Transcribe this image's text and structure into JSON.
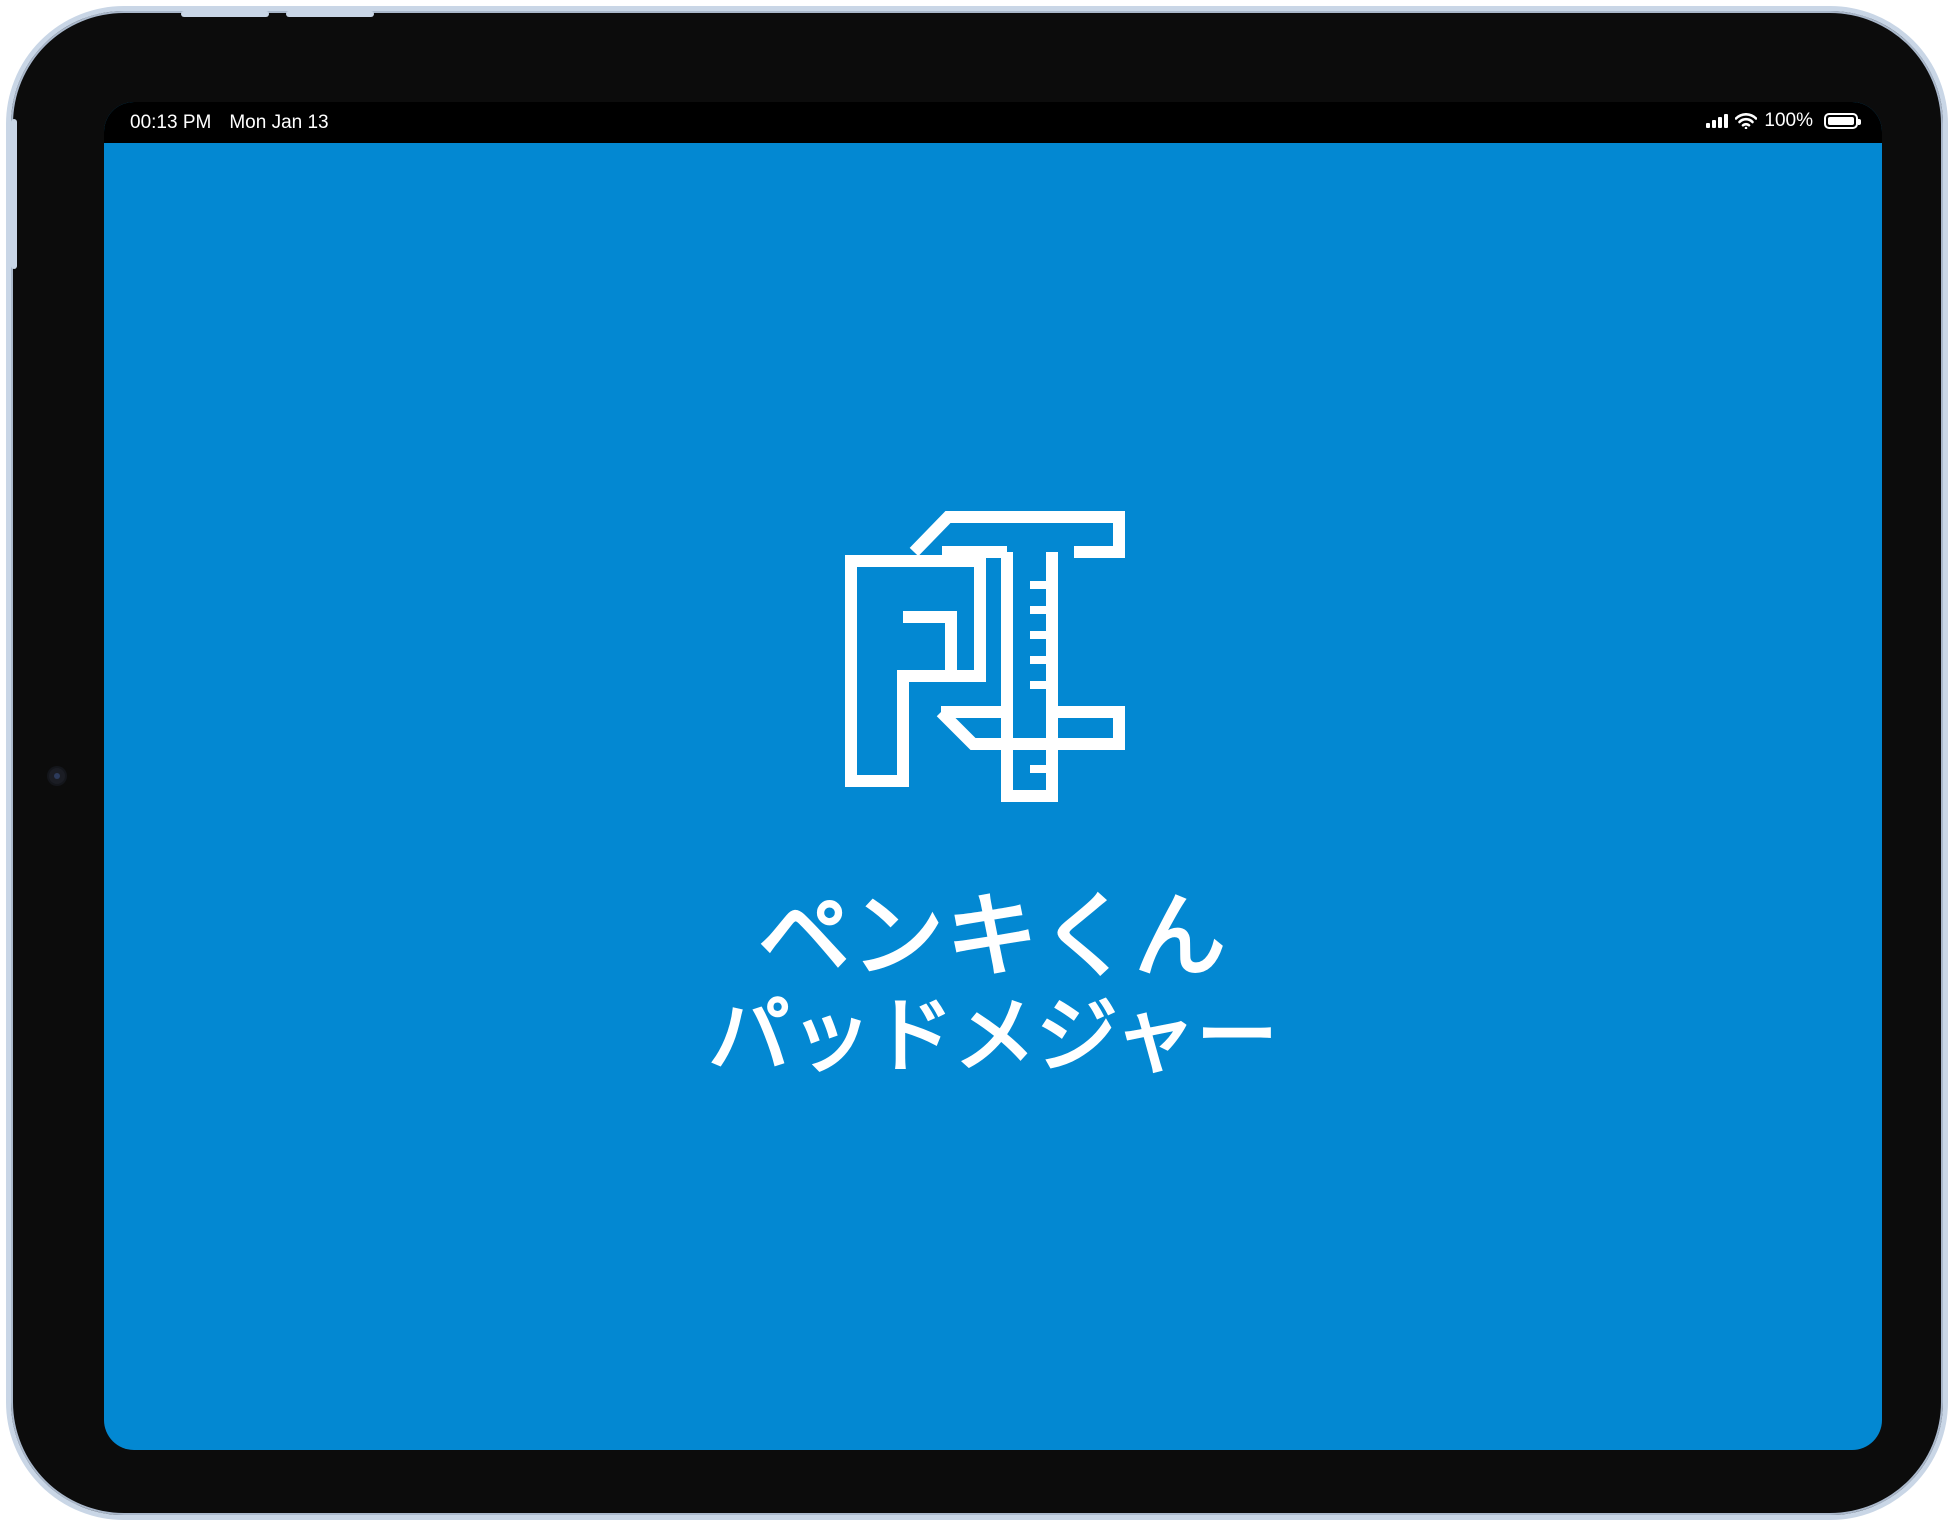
{
  "status_bar": {
    "time": "00:13 PM",
    "date": "Mon Jan 13",
    "battery_percent": "100%",
    "battery_level": 1.0,
    "signal_icon": "cellular-signal-icon",
    "wifi_icon": "wifi-icon",
    "battery_icon": "battery-icon"
  },
  "splash": {
    "logo_icon": "paint-pad-ruler-logo-icon",
    "title_line_1": "ペンキくん",
    "title_line_2": "パッドメジャー",
    "background_color": "#0388d2",
    "foreground_color": "#ffffff"
  }
}
